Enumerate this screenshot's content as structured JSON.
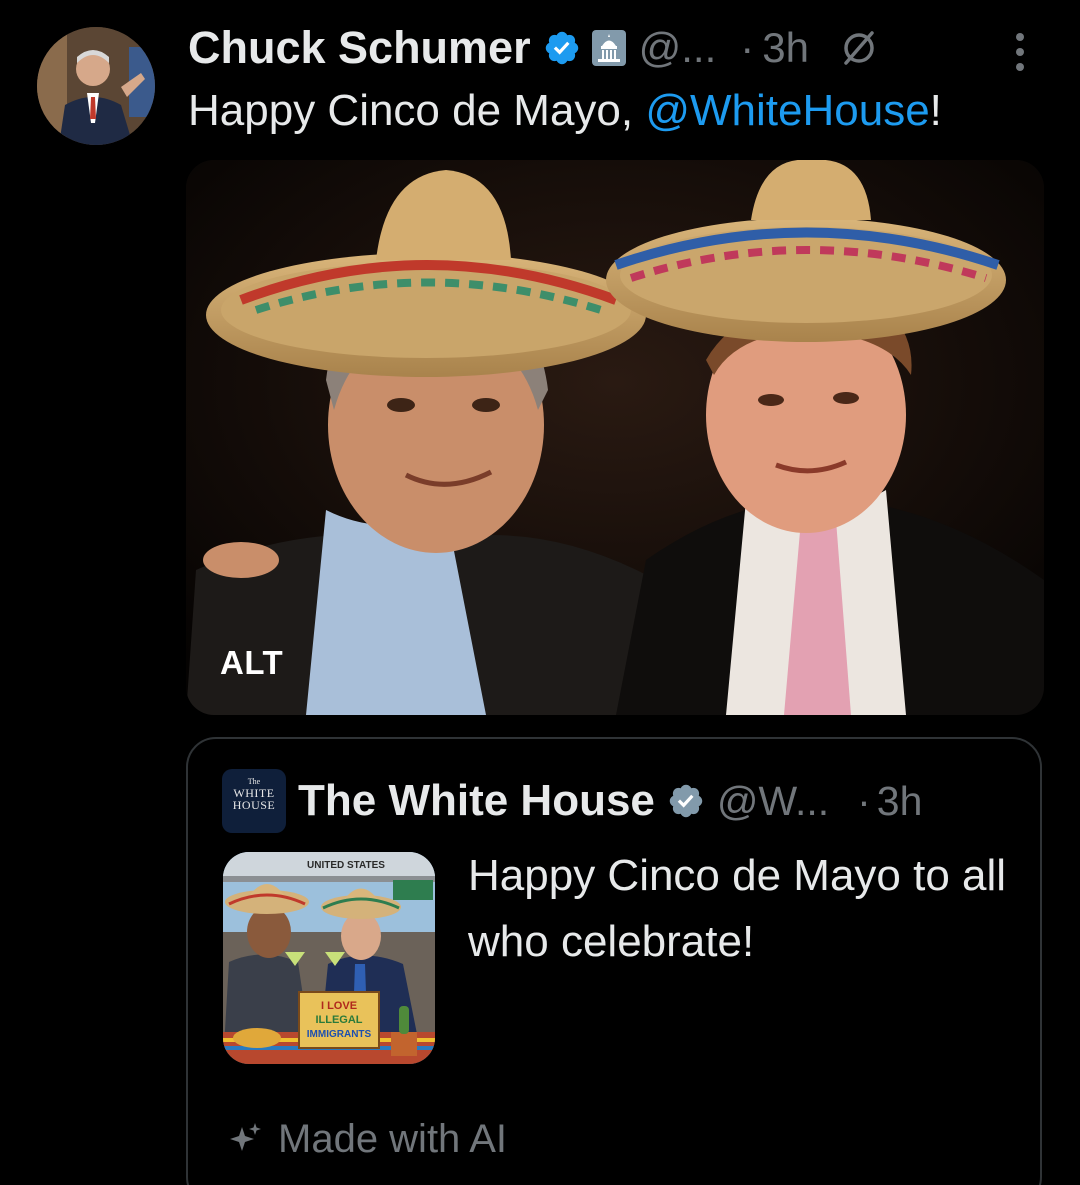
{
  "tweet": {
    "author": {
      "display_name": "Chuck Schumer",
      "handle": "@...",
      "time": "3h",
      "separator": "·"
    },
    "text_before": "Happy Cinco de Mayo, ",
    "mention": "@WhiteHouse",
    "text_after": "!",
    "media": {
      "alt_label": "ALT"
    },
    "icons": {
      "verified": "verified-badge-icon",
      "government": "capitol-government-icon",
      "replies_limited": "no-reply-circle-slash-icon",
      "more": "more-vertical-icon"
    }
  },
  "quote": {
    "author": {
      "display_name": "The White House",
      "handle": "@W...",
      "time": "3h",
      "separator": "·",
      "avatar_lines": [
        "The",
        "WHITE",
        "HOUSE"
      ]
    },
    "text": "Happy Cinco de Mayo to all who celebrate!",
    "thumbnail": {
      "sign_top": "UNITED STATES",
      "sign_lines": [
        "I LOVE",
        "ILLEGAL",
        "IMMIGRANTS"
      ]
    },
    "footer_label": "Made with AI",
    "footer_icon": "sparkle-icon"
  },
  "colors": {
    "background": "#000000",
    "text_primary": "#e7e9ea",
    "text_secondary": "#71767b",
    "link": "#1d9bf0",
    "verified": "#1d9bf0",
    "border": "#2f3336"
  }
}
